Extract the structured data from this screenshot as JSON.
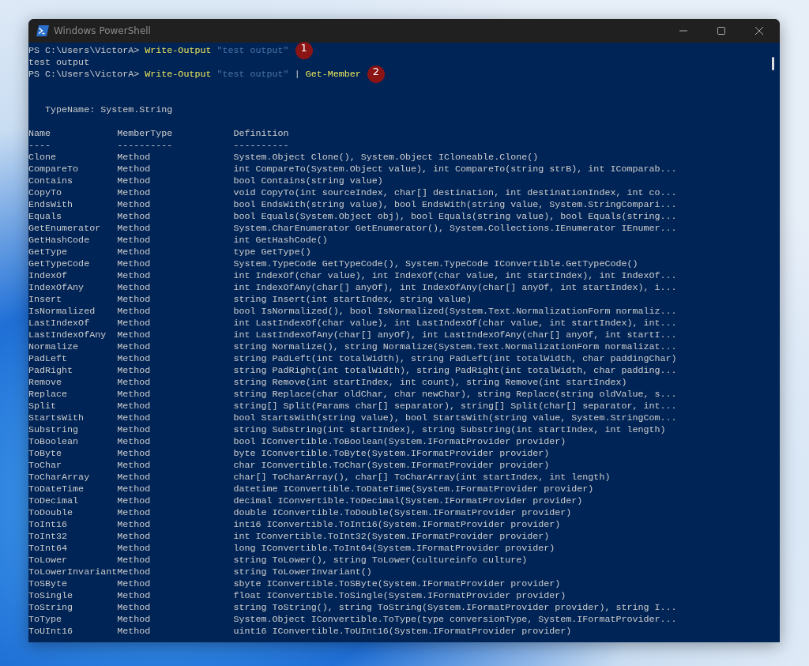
{
  "window": {
    "title": "Windows PowerShell"
  },
  "console": {
    "lines": [
      {
        "kind": "command",
        "prompt": "PS C:\\Users\\VictorA>",
        "tokens": [
          {
            "kind": "cmdlet",
            "text": "Write-Output"
          },
          {
            "kind": "string",
            "text": "\"test output\""
          }
        ],
        "badge": "1"
      },
      {
        "kind": "output",
        "text": "test output"
      },
      {
        "kind": "command",
        "prompt": "PS C:\\Users\\VictorA>",
        "tokens": [
          {
            "kind": "cmdlet",
            "text": "Write-Output"
          },
          {
            "kind": "string",
            "text": "\"test output\""
          },
          {
            "kind": "operator",
            "text": "|"
          },
          {
            "kind": "cmdlet",
            "text": "Get-Member"
          }
        ],
        "badge": "2"
      }
    ],
    "type_name": "TypeName: System.String",
    "table": {
      "columns": [
        "Name",
        "MemberType",
        "Definition"
      ],
      "underlines": [
        "----",
        "----------",
        "----------"
      ],
      "rows": [
        [
          "Clone",
          "Method",
          "System.Object Clone(), System.Object ICloneable.Clone()"
        ],
        [
          "CompareTo",
          "Method",
          "int CompareTo(System.Object value), int CompareTo(string strB), int IComparab..."
        ],
        [
          "Contains",
          "Method",
          "bool Contains(string value)"
        ],
        [
          "CopyTo",
          "Method",
          "void CopyTo(int sourceIndex, char[] destination, int destinationIndex, int co..."
        ],
        [
          "EndsWith",
          "Method",
          "bool EndsWith(string value), bool EndsWith(string value, System.StringCompari..."
        ],
        [
          "Equals",
          "Method",
          "bool Equals(System.Object obj), bool Equals(string value), bool Equals(string..."
        ],
        [
          "GetEnumerator",
          "Method",
          "System.CharEnumerator GetEnumerator(), System.Collections.IEnumerator IEnumer..."
        ],
        [
          "GetHashCode",
          "Method",
          "int GetHashCode()"
        ],
        [
          "GetType",
          "Method",
          "type GetType()"
        ],
        [
          "GetTypeCode",
          "Method",
          "System.TypeCode GetTypeCode(), System.TypeCode IConvertible.GetTypeCode()"
        ],
        [
          "IndexOf",
          "Method",
          "int IndexOf(char value), int IndexOf(char value, int startIndex), int IndexOf..."
        ],
        [
          "IndexOfAny",
          "Method",
          "int IndexOfAny(char[] anyOf), int IndexOfAny(char[] anyOf, int startIndex), i..."
        ],
        [
          "Insert",
          "Method",
          "string Insert(int startIndex, string value)"
        ],
        [
          "IsNormalized",
          "Method",
          "bool IsNormalized(), bool IsNormalized(System.Text.NormalizationForm normaliz..."
        ],
        [
          "LastIndexOf",
          "Method",
          "int LastIndexOf(char value), int LastIndexOf(char value, int startIndex), int..."
        ],
        [
          "LastIndexOfAny",
          "Method",
          "int LastIndexOfAny(char[] anyOf), int LastIndexOfAny(char[] anyOf, int startI..."
        ],
        [
          "Normalize",
          "Method",
          "string Normalize(), string Normalize(System.Text.NormalizationForm normalizat..."
        ],
        [
          "PadLeft",
          "Method",
          "string PadLeft(int totalWidth), string PadLeft(int totalWidth, char paddingChar)"
        ],
        [
          "PadRight",
          "Method",
          "string PadRight(int totalWidth), string PadRight(int totalWidth, char padding..."
        ],
        [
          "Remove",
          "Method",
          "string Remove(int startIndex, int count), string Remove(int startIndex)"
        ],
        [
          "Replace",
          "Method",
          "string Replace(char oldChar, char newChar), string Replace(string oldValue, s..."
        ],
        [
          "Split",
          "Method",
          "string[] Split(Params char[] separator), string[] Split(char[] separator, int..."
        ],
        [
          "StartsWith",
          "Method",
          "bool StartsWith(string value), bool StartsWith(string value, System.StringCom..."
        ],
        [
          "Substring",
          "Method",
          "string Substring(int startIndex), string Substring(int startIndex, int length)"
        ],
        [
          "ToBoolean",
          "Method",
          "bool IConvertible.ToBoolean(System.IFormatProvider provider)"
        ],
        [
          "ToByte",
          "Method",
          "byte IConvertible.ToByte(System.IFormatProvider provider)"
        ],
        [
          "ToChar",
          "Method",
          "char IConvertible.ToChar(System.IFormatProvider provider)"
        ],
        [
          "ToCharArray",
          "Method",
          "char[] ToCharArray(), char[] ToCharArray(int startIndex, int length)"
        ],
        [
          "ToDateTime",
          "Method",
          "datetime IConvertible.ToDateTime(System.IFormatProvider provider)"
        ],
        [
          "ToDecimal",
          "Method",
          "decimal IConvertible.ToDecimal(System.IFormatProvider provider)"
        ],
        [
          "ToDouble",
          "Method",
          "double IConvertible.ToDouble(System.IFormatProvider provider)"
        ],
        [
          "ToInt16",
          "Method",
          "int16 IConvertible.ToInt16(System.IFormatProvider provider)"
        ],
        [
          "ToInt32",
          "Method",
          "int IConvertible.ToInt32(System.IFormatProvider provider)"
        ],
        [
          "ToInt64",
          "Method",
          "long IConvertible.ToInt64(System.IFormatProvider provider)"
        ],
        [
          "ToLower",
          "Method",
          "string ToLower(), string ToLower(cultureinfo culture)"
        ],
        [
          "ToLowerInvariant",
          "Method",
          "string ToLowerInvariant()"
        ],
        [
          "ToSByte",
          "Method",
          "sbyte IConvertible.ToSByte(System.IFormatProvider provider)"
        ],
        [
          "ToSingle",
          "Method",
          "float IConvertible.ToSingle(System.IFormatProvider provider)"
        ],
        [
          "ToString",
          "Method",
          "string ToString(), string ToString(System.IFormatProvider provider), string I..."
        ],
        [
          "ToType",
          "Method",
          "System.Object IConvertible.ToType(type conversionType, System.IFormatProvider..."
        ],
        [
          "ToUInt16",
          "Method",
          "uint16 IConvertible.ToUInt16(System.IFormatProvider provider)"
        ]
      ]
    }
  }
}
